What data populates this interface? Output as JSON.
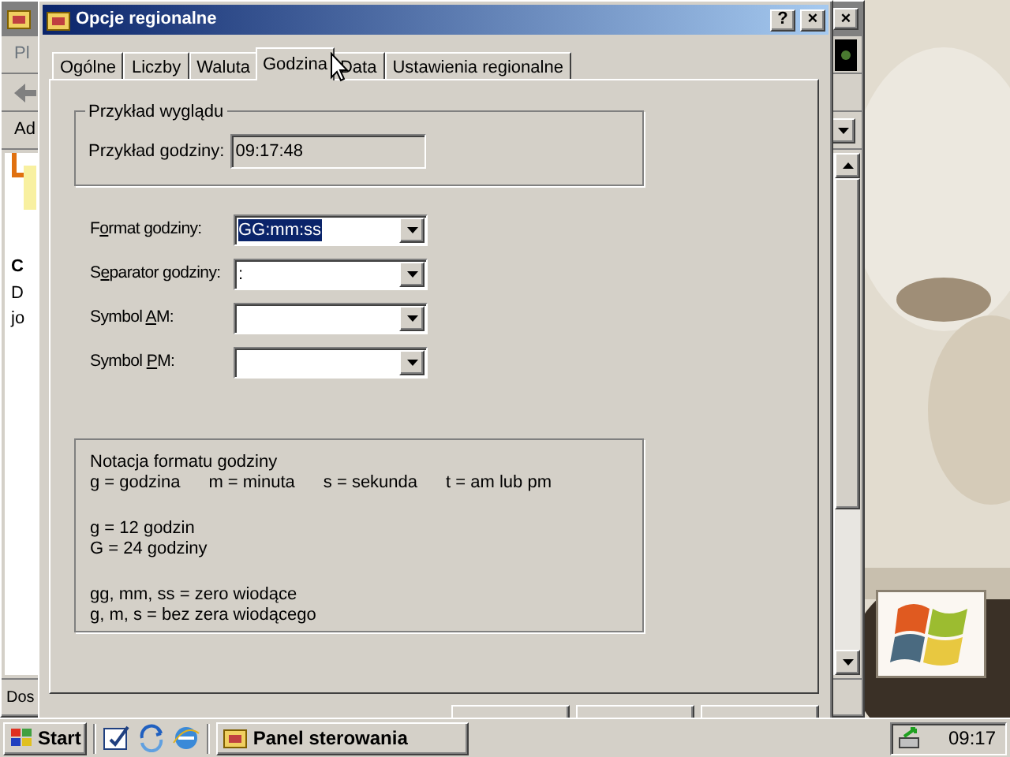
{
  "background_window": {
    "close_glyph": "×",
    "toolbar_text": "Pl",
    "address_label": "Ad",
    "content_texts": [
      "C",
      "D",
      "jo"
    ],
    "status_text": "Dos"
  },
  "dialog": {
    "title": "Opcje regionalne",
    "title_buttons": [
      "?",
      "×"
    ]
  },
  "tabs": [
    {
      "label": "Ogólne",
      "selected": false
    },
    {
      "label": "Liczby",
      "selected": false
    },
    {
      "label": "Waluta",
      "selected": false
    },
    {
      "label": "Godzina",
      "selected": true
    },
    {
      "label": "Data",
      "selected": false
    },
    {
      "label": "Ustawienia regionalne",
      "selected": false
    }
  ],
  "appearance_group": {
    "title": "Przykład wyglądu",
    "label": "Przykład godziny:",
    "value": "09:17:48"
  },
  "fields": [
    {
      "label_before": "F",
      "access_key": "o",
      "label_after": "rmat godziny:",
      "value": "GG:mm:ss",
      "value_selected": true
    },
    {
      "label_before": "S",
      "access_key": "e",
      "label_after": "parator godziny:",
      "value": ":",
      "value_selected": false
    },
    {
      "label_before": "Symbol ",
      "access_key": "A",
      "label_after": "M:"
    },
    {
      "label_before": "Symbol ",
      "access_key": "P",
      "label_after": "M:"
    }
  ],
  "notation_group": {
    "heading": "Notacja formatu godziny",
    "legend": [
      "g = godzina",
      "m = minuta",
      "s = sekunda",
      "t = am lub pm"
    ],
    "blocks": [
      [
        "g = 12 godzin",
        "G = 24 godziny"
      ],
      [
        "gg, mm, ss = zero wiodące",
        "g, m, s = bez zera wiodącego"
      ]
    ]
  },
  "taskbar": {
    "start": "Start",
    "tasks": [
      {
        "label": "Panel sterowania",
        "selected": false
      }
    ],
    "clock": "09:17"
  }
}
